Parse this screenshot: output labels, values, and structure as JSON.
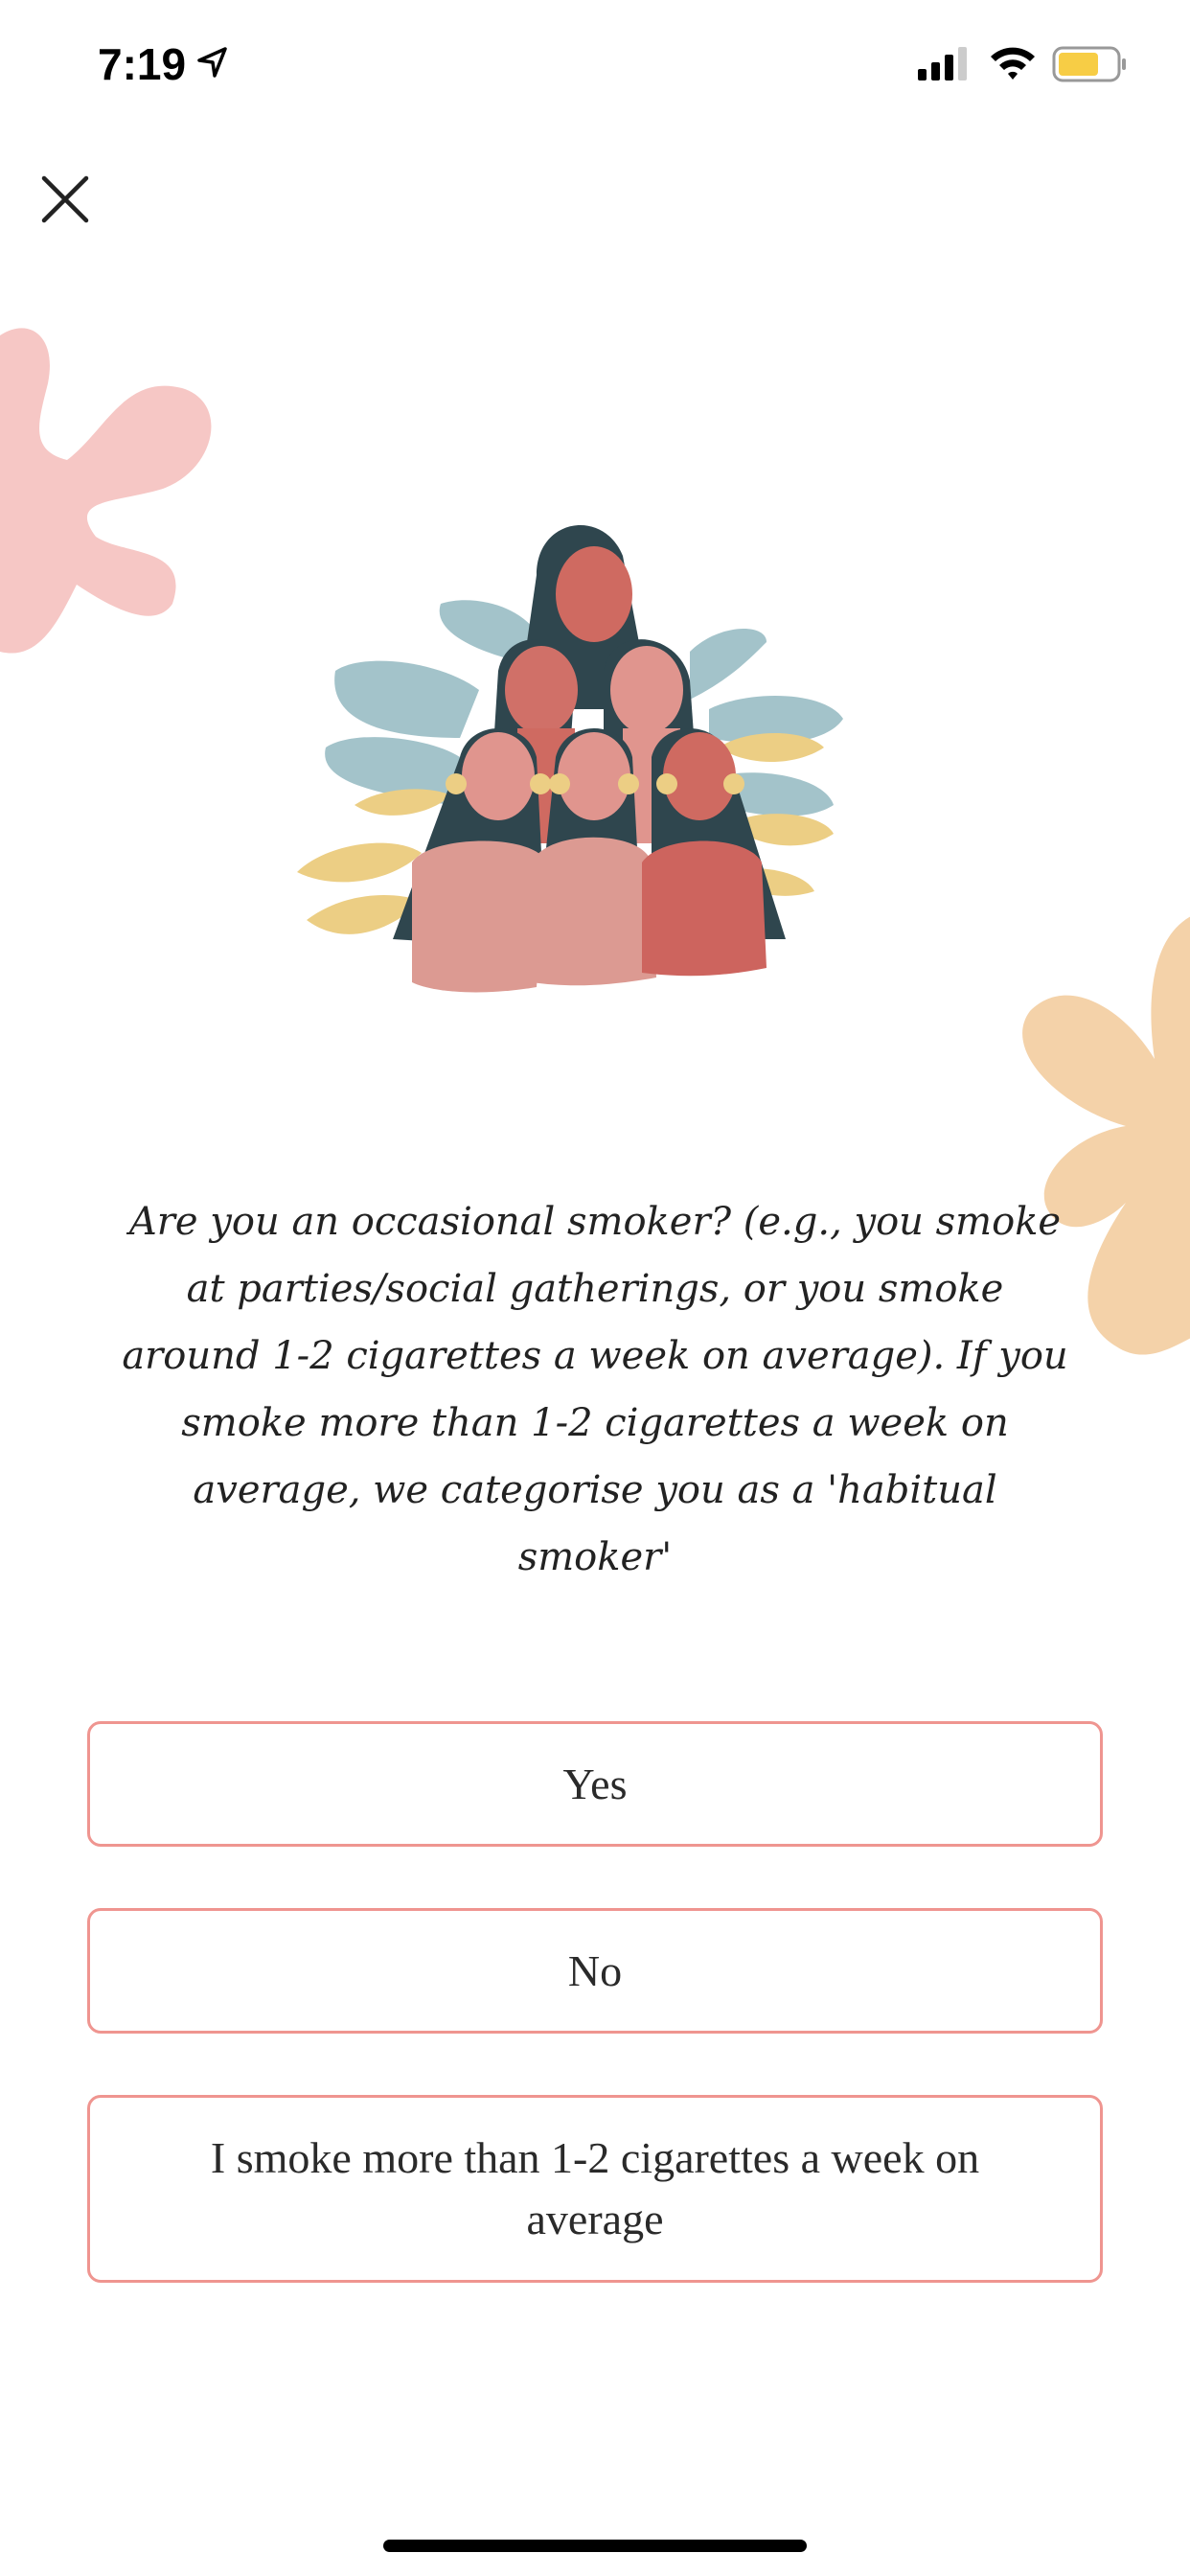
{
  "status_bar": {
    "time": "7:19",
    "battery_color": "#f7cd45"
  },
  "header": {
    "close_icon": "close-icon"
  },
  "question": "Are you an occasional smoker? (e.g., you smoke at parties/social gatherings, or you smoke around 1-2 cigarettes a week on average). If you smoke more than 1-2 cigarettes a week on average, we categorise you as a 'habitual smoker'",
  "options": [
    {
      "label": "Yes"
    },
    {
      "label": "No"
    },
    {
      "label": "I smoke more than 1-2 cigarettes a week on average"
    }
  ],
  "colors": {
    "option_border": "#ef9590",
    "blob_pink": "#f6c7c5",
    "blob_peach": "#f4d2a9"
  }
}
